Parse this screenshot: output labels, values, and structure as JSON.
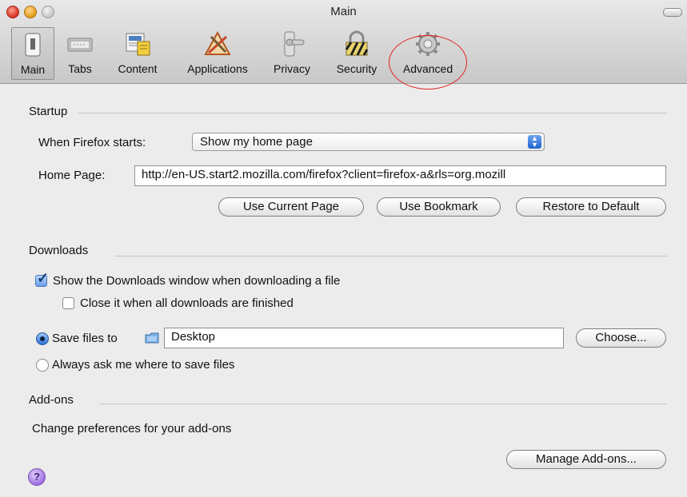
{
  "window": {
    "title": "Main"
  },
  "toolbar": {
    "items": [
      {
        "label": "Main",
        "icon": "main-switch-icon",
        "selected": true
      },
      {
        "label": "Tabs",
        "icon": "tabs-icon"
      },
      {
        "label": "Content",
        "icon": "content-icon"
      },
      {
        "label": "Applications",
        "icon": "applications-icon"
      },
      {
        "label": "Privacy",
        "icon": "privacy-doorhandle-icon"
      },
      {
        "label": "Security",
        "icon": "security-lock-icon"
      },
      {
        "label": "Advanced",
        "icon": "advanced-gear-icon"
      }
    ],
    "highlight_color": "#e3201b"
  },
  "startup": {
    "section_title": "Startup",
    "when_label": "When Firefox starts:",
    "when_value": "Show my home page",
    "home_label": "Home Page:",
    "home_value": "http://en-US.start2.mozilla.com/firefox?client=firefox-a&rls=org.mozill",
    "buttons": {
      "use_current": "Use Current Page",
      "use_bookmark": "Use Bookmark",
      "restore_default": "Restore to Default"
    }
  },
  "downloads": {
    "section_title": "Downloads",
    "show_window_label": "Show the Downloads window when downloading a file",
    "show_window_checked": true,
    "close_it_label": "Close it when all downloads are finished",
    "close_it_checked": false,
    "save_to_label": "Save files to",
    "save_to_selected": true,
    "save_to_value": "Desktop",
    "choose_button": "Choose...",
    "always_ask_label": "Always ask me where to save files",
    "always_ask_selected": false
  },
  "addons": {
    "section_title": "Add-ons",
    "description": "Change preferences for your add-ons",
    "manage_button": "Manage Add-ons..."
  },
  "help": {
    "glyph": "?"
  }
}
